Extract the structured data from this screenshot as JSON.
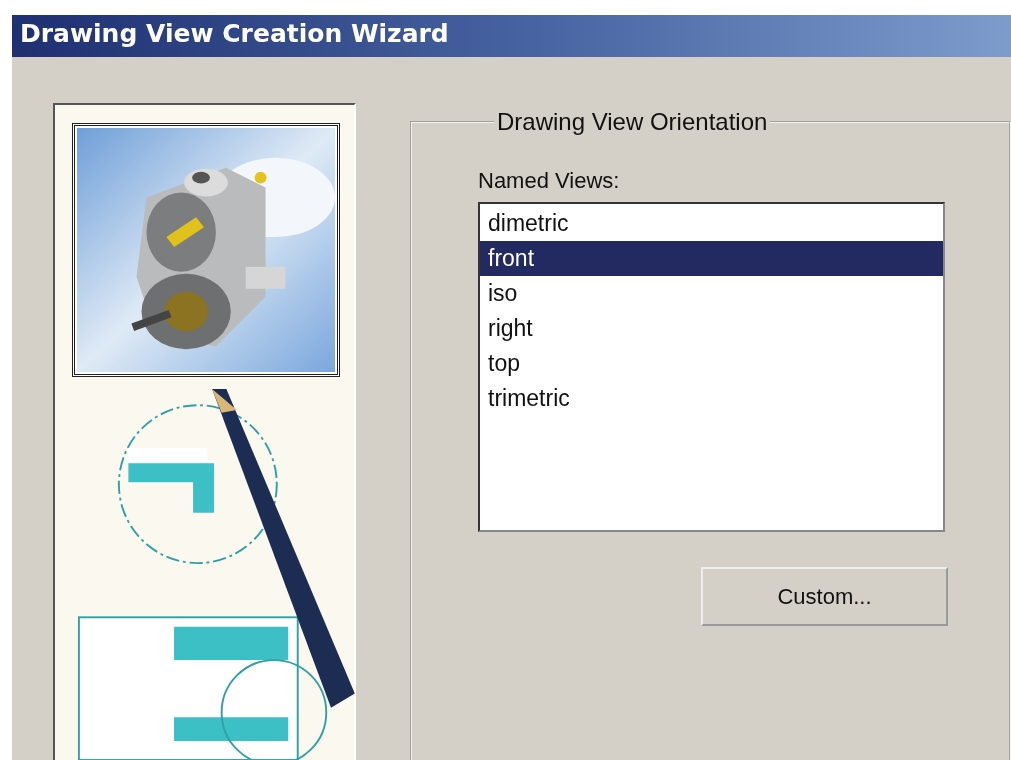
{
  "window": {
    "title": "Drawing View Creation Wizard"
  },
  "orientation_group": {
    "title": "Drawing View Orientation",
    "named_views_label": "Named Views:",
    "named_views": [
      {
        "label": "dimetric",
        "selected": false
      },
      {
        "label": "front",
        "selected": true
      },
      {
        "label": "iso",
        "selected": false
      },
      {
        "label": "right",
        "selected": false
      },
      {
        "label": "top",
        "selected": false
      },
      {
        "label": "trimetric",
        "selected": false
      }
    ],
    "buttons": [
      "Custom..."
    ]
  }
}
